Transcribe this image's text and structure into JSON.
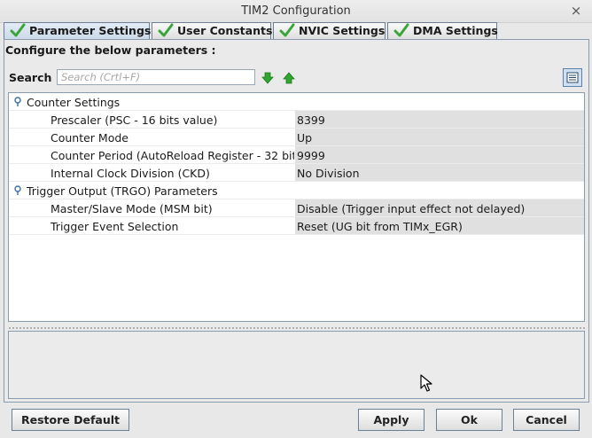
{
  "window": {
    "title": "TIM2 Configuration",
    "close_glyph": "×"
  },
  "tabs": [
    {
      "label": "Parameter Settings",
      "active": true,
      "icon": "check-icon"
    },
    {
      "label": "User Constants",
      "active": false,
      "icon": "check-icon"
    },
    {
      "label": "NVIC Settings",
      "active": false,
      "icon": "check-icon"
    },
    {
      "label": "DMA Settings",
      "active": false,
      "icon": "check-icon"
    }
  ],
  "content": {
    "instruction": "Configure the below parameters :",
    "search": {
      "label": "Search :",
      "placeholder": "Search (Crtl+F)"
    }
  },
  "groups": [
    {
      "title": "Counter Settings",
      "params": [
        {
          "name": "Prescaler (PSC - 16 bits value)",
          "value": "8399"
        },
        {
          "name": "Counter Mode",
          "value": "Up"
        },
        {
          "name": "Counter Period (AutoReload Register - 32 bits val...",
          "value": "9999"
        },
        {
          "name": "Internal Clock Division (CKD)",
          "value": "No Division"
        }
      ]
    },
    {
      "title": "Trigger Output (TRGO) Parameters",
      "params": [
        {
          "name": "Master/Slave Mode (MSM bit)",
          "value": "Disable (Trigger input effect not delayed)"
        },
        {
          "name": "Trigger Event Selection",
          "value": "Reset (UG bit from TIMx_EGR)"
        }
      ]
    }
  ],
  "buttons": {
    "restore_default": "Restore Default",
    "apply": "Apply",
    "ok": "Ok",
    "cancel": "Cancel"
  },
  "colors": {
    "check_green": "#3aa53a",
    "arrow_green": "#2fa42f",
    "value_bg": "#e0e0e0",
    "active_tab": "#c9d7e6"
  }
}
